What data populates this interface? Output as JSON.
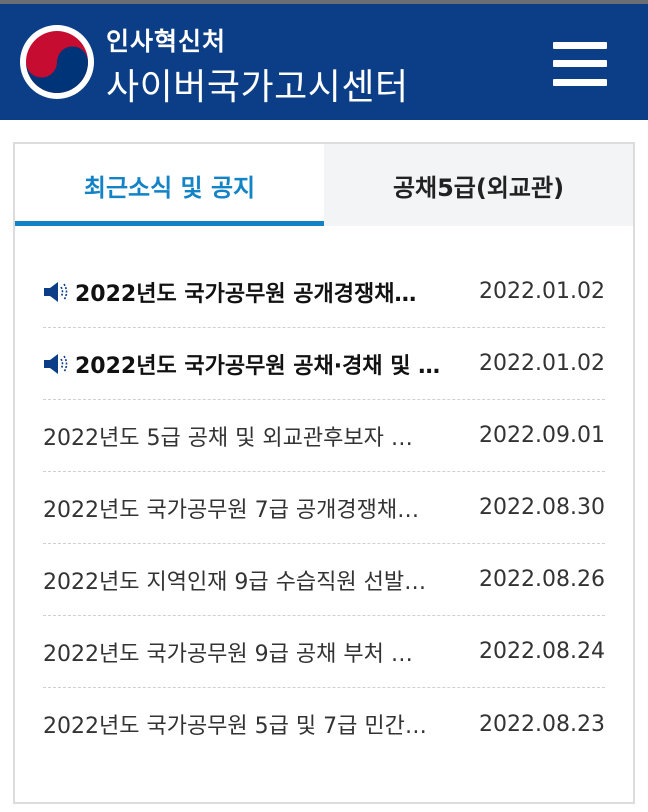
{
  "header": {
    "org_name": "인사혁신처",
    "site_name": "사이버국가고시센터",
    "menu_icon": "hamburger-menu-icon",
    "colors": {
      "header_bg": "#0b3e87",
      "accent": "#1283c6"
    }
  },
  "tabs": [
    {
      "label": "최근소식 및 공지",
      "active": true
    },
    {
      "label": "공채5급(외교관)",
      "active": false
    }
  ],
  "posts": [
    {
      "title": "2022년도 국가공무원 공개경쟁채…",
      "date": "2022.01.02",
      "notice": true
    },
    {
      "title": "2022년도 국가공무원 공채·경채 및 …",
      "date": "2022.01.02",
      "notice": true
    },
    {
      "title": "2022년도 5급 공채 및 외교관후보자 …",
      "date": "2022.09.01",
      "notice": false
    },
    {
      "title": "2022년도 국가공무원 7급 공개경쟁채…",
      "date": "2022.08.30",
      "notice": false
    },
    {
      "title": "2022년도 지역인재 9급 수습직원 선발…",
      "date": "2022.08.26",
      "notice": false
    },
    {
      "title": "2022년도 국가공무원 9급 공채 부처 …",
      "date": "2022.08.24",
      "notice": false
    },
    {
      "title": "2022년도 국가공무원 5급 및 7급 민간…",
      "date": "2022.08.23",
      "notice": false
    }
  ]
}
